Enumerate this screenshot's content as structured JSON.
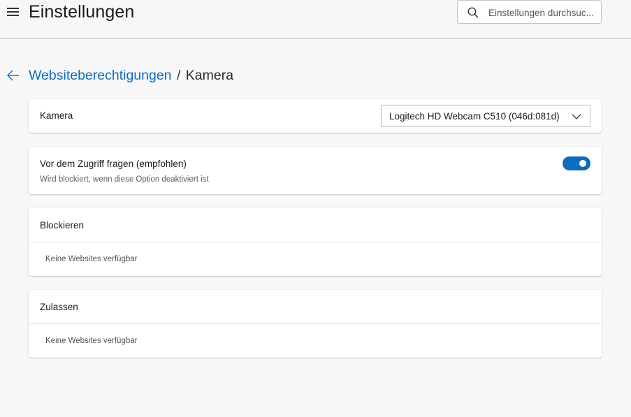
{
  "header": {
    "title": "Einstellungen",
    "search_placeholder": "Einstellungen durchsuc..."
  },
  "breadcrumb": {
    "parent": "Websiteberechtigungen",
    "separator": "/",
    "current": "Kamera"
  },
  "camera": {
    "label": "Kamera",
    "selected_device": "Logitech HD Webcam C510 (046d:081d)"
  },
  "ask_before_access": {
    "label": "Vor dem Zugriff fragen (empfohlen)",
    "sublabel": "Wird blockiert, wenn diese Option deaktiviert ist",
    "enabled": true
  },
  "block": {
    "title": "Blockieren",
    "empty_text": "Keine Websites verfügbar"
  },
  "allow": {
    "title": "Zulassen",
    "empty_text": "Keine Websites verfügbar"
  },
  "colors": {
    "accent": "#0f6cbd",
    "background": "#f7f7f7",
    "card": "#ffffff"
  },
  "icons": {
    "menu": "hamburger-menu-icon",
    "search": "search-icon",
    "back": "arrow-left-icon",
    "dropdown": "chevron-down-icon"
  }
}
